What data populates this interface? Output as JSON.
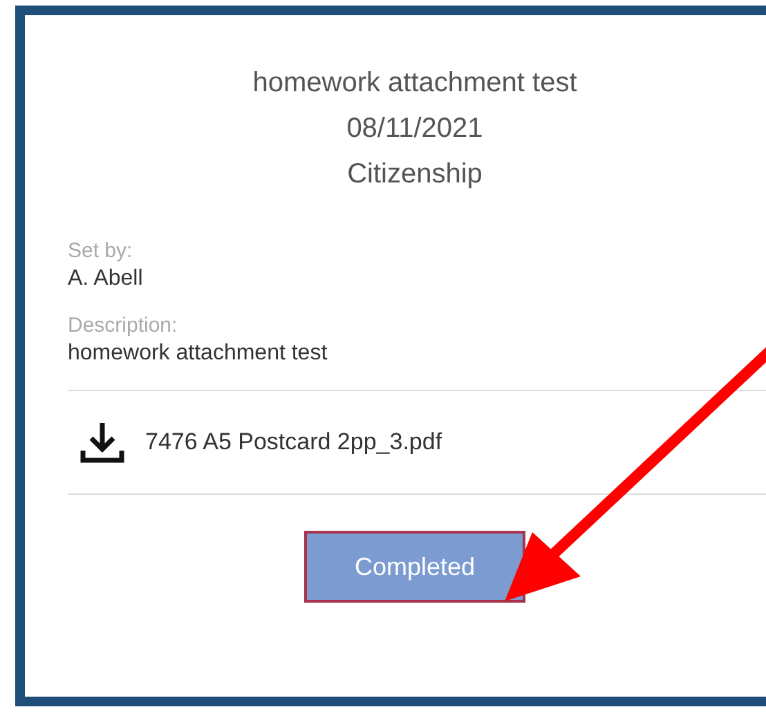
{
  "header": {
    "title": "homework attachment test",
    "date": "08/11/2021",
    "subject": "Citizenship"
  },
  "details": [
    {
      "label": "Set by:",
      "value": "A. Abell"
    },
    {
      "label": "Description:",
      "value": "homework attachment test"
    }
  ],
  "attachments": [
    {
      "name": "7476 A5 Postcard 2pp_3.pdf"
    }
  ],
  "button": {
    "label": "Completed"
  }
}
